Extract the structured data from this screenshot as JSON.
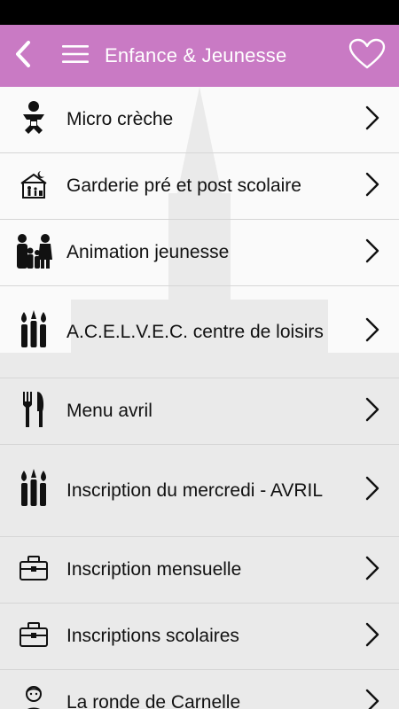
{
  "header": {
    "title": "Enfance & Jeunesse",
    "back_icon": "chevron-left-icon",
    "menu_icon": "hamburger-menu-icon",
    "favorite_icon": "heart-outline-icon",
    "background_color": "#c97ac4"
  },
  "items": [
    {
      "label": "Micro crèche",
      "icon": "baby-icon"
    },
    {
      "label": "Garderie pré et post scolaire",
      "icon": "house-family-icon"
    },
    {
      "label": "Animation jeunesse",
      "icon": "family-icon"
    },
    {
      "label": "A.C.E.L.V.E.C. centre de loisirs",
      "icon": "paint-brushes-icon"
    },
    {
      "label": "Menu avril",
      "icon": "fork-knife-icon"
    },
    {
      "label": "Inscription du mercredi - AVRIL",
      "icon": "paint-brushes-icon"
    },
    {
      "label": "Inscription mensuelle",
      "icon": "briefcase-icon"
    },
    {
      "label": "Inscriptions scolaires",
      "icon": "briefcase-icon"
    },
    {
      "label": "La ronde de Carnelle",
      "icon": "child-icon"
    }
  ]
}
